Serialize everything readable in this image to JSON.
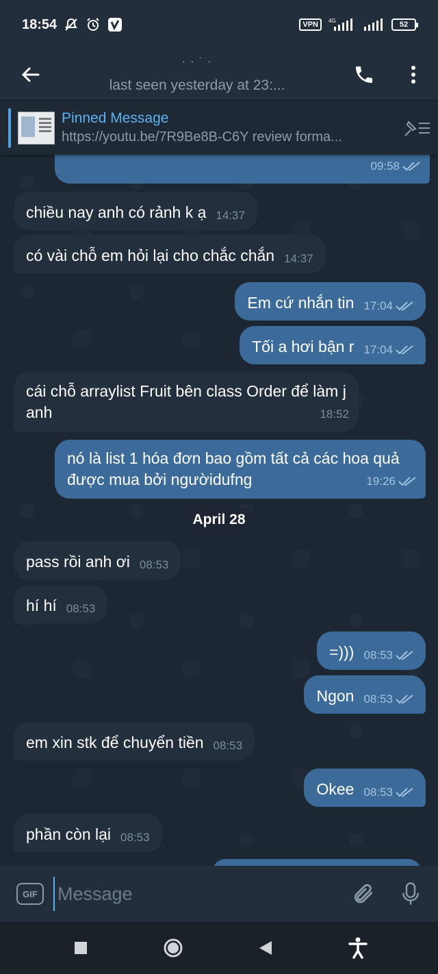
{
  "status_bar": {
    "time": "18:54",
    "vpn": "VPN",
    "network": "4G",
    "battery": "52"
  },
  "header": {
    "last_seen": "last seen yesterday at 23:..."
  },
  "pinned": {
    "title": "Pinned Message",
    "text": "https://youtu.be/7R9Be8B-C6Y  review forma..."
  },
  "messages": [
    {
      "direction": "out",
      "text": "",
      "time": "09:58",
      "read": true
    },
    {
      "direction": "in",
      "text": "chiều nay anh có rảnh k ạ",
      "time": "14:37"
    },
    {
      "direction": "in",
      "text": "có vài chỗ em hỏi lại cho chắc chắn",
      "time": "14:37"
    },
    {
      "direction": "out",
      "text": "Em cứ nhắn tin",
      "time": "17:04",
      "read": true
    },
    {
      "direction": "out",
      "text": "Tối a hơi bận r",
      "time": "17:04",
      "read": true
    },
    {
      "direction": "in",
      "text": "cái chỗ arraylist Fruit bên class Order để làm j anh",
      "time": "18:52"
    },
    {
      "direction": "out",
      "text": "nó là list 1 hóa đơn bao gồm tất cả các hoa quả được mua bởi ngườidufng",
      "time": "19:26",
      "read": true
    },
    {
      "direction": "in",
      "text": "pass rồi anh ơi",
      "time": "08:53"
    },
    {
      "direction": "in",
      "text": "hí hí",
      "time": "08:53"
    },
    {
      "direction": "out",
      "text": "=)))",
      "time": "08:53",
      "read": true
    },
    {
      "direction": "out",
      "text": "Ngon",
      "time": "08:53",
      "read": true
    },
    {
      "direction": "in",
      "text": "em xin stk để chuyển tiền",
      "time": "08:53"
    },
    {
      "direction": "out",
      "text": "Okee",
      "time": "08:53",
      "read": true
    },
    {
      "direction": "in",
      "text": "phần còn lại",
      "time": "08:53"
    }
  ],
  "date_separator": "April 28",
  "input": {
    "placeholder": "Message",
    "gif_label": "GIF"
  },
  "colors": {
    "background": "#1d2733",
    "incoming_bubble": "#232f3d",
    "outgoing_bubble": "#3c6b99",
    "accent": "#5eb2f0"
  }
}
